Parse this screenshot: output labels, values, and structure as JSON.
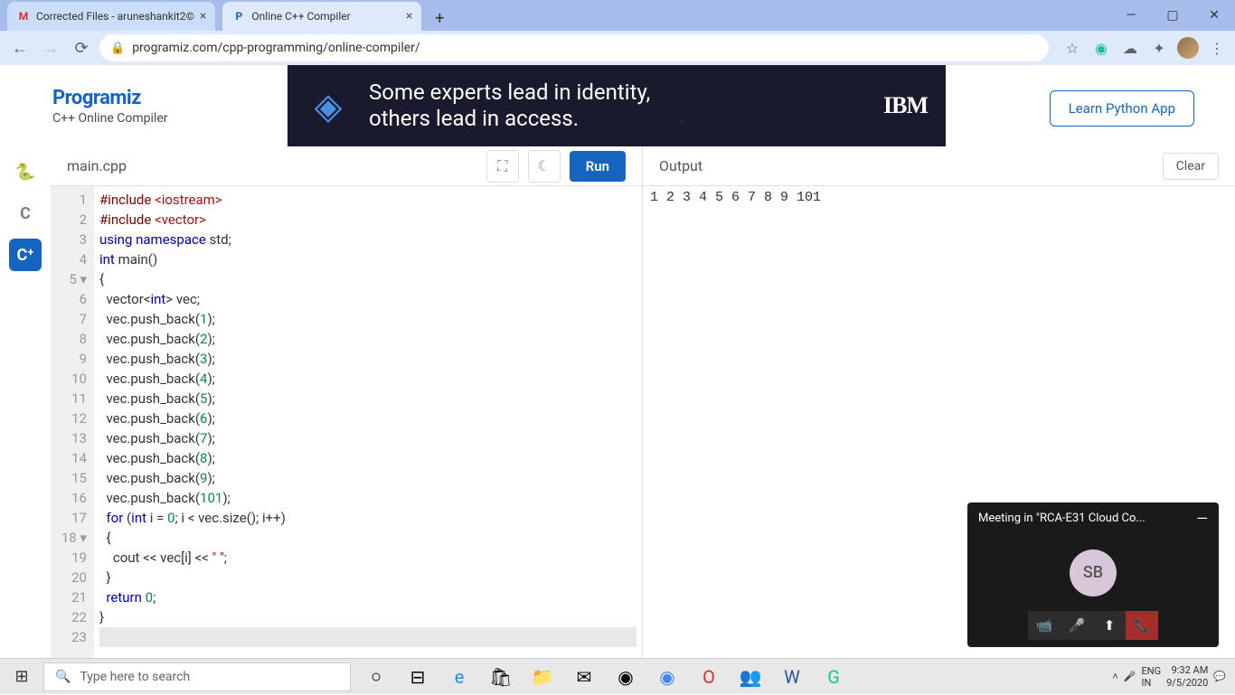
{
  "tabs": [
    {
      "title": "Corrected Files - aruneshankit2©",
      "favicon": "M"
    },
    {
      "title": "Online C++ Compiler",
      "favicon": "P"
    }
  ],
  "url": "programiz.com/cpp-programming/online-compiler/",
  "logo": {
    "text": "Programiz",
    "sub": "C++ Online Compiler"
  },
  "ad": {
    "line1": "Some experts lead in identity,",
    "line2": "others lead in access.",
    "brand": "IBM"
  },
  "learn_btn": "Learn Python App",
  "sidebar_icons": [
    "Py",
    "C",
    "C++"
  ],
  "filename": "main.cpp",
  "run_label": "Run",
  "output_label": "Output",
  "clear_label": "Clear",
  "output_text": "1 2 3 4 5 6 7 8 9 101 ",
  "code_lines": [
    {
      "n": "1",
      "html": "<span class='inc'>#include</span> <span class='str'>&lt;iostream&gt;</span>"
    },
    {
      "n": "2",
      "html": "<span class='inc'>#include</span> <span class='str'>&lt;vector&gt;</span>"
    },
    {
      "n": "3",
      "html": "<span class='kw'>using</span> <span class='kw'>namespace</span> std;"
    },
    {
      "n": "4",
      "html": "<span class='kw'>int</span> main()"
    },
    {
      "n": "5 ▾",
      "html": "{"
    },
    {
      "n": "6",
      "html": "  vector&lt;<span class='kw'>int</span>&gt; vec;"
    },
    {
      "n": "7",
      "html": "  vec.push_back(<span class='num'>1</span>);"
    },
    {
      "n": "8",
      "html": "  vec.push_back(<span class='num'>2</span>);"
    },
    {
      "n": "9",
      "html": "  vec.push_back(<span class='num'>3</span>);"
    },
    {
      "n": "10",
      "html": "  vec.push_back(<span class='num'>4</span>);"
    },
    {
      "n": "11",
      "html": "  vec.push_back(<span class='num'>5</span>);"
    },
    {
      "n": "12",
      "html": "  vec.push_back(<span class='num'>6</span>);"
    },
    {
      "n": "13",
      "html": "  vec.push_back(<span class='num'>7</span>);"
    },
    {
      "n": "14",
      "html": "  vec.push_back(<span class='num'>8</span>);"
    },
    {
      "n": "15",
      "html": "  vec.push_back(<span class='num'>9</span>);"
    },
    {
      "n": "16",
      "html": "  vec.push_back(<span class='num'>101</span>);"
    },
    {
      "n": "17",
      "html": "  <span class='kw'>for</span> (<span class='kw'>int</span> i = <span class='num'>0</span>; i &lt; vec.size(); i++)"
    },
    {
      "n": "18 ▾",
      "html": "  {"
    },
    {
      "n": "19",
      "html": "    cout &lt;&lt; vec[i] &lt;&lt; <span class='str'>\" \"</span>;"
    },
    {
      "n": "20",
      "html": "  }"
    },
    {
      "n": "21",
      "html": "  <span class='kw'>return</span> <span class='num'>0</span>;"
    },
    {
      "n": "22",
      "html": "}"
    },
    {
      "n": "23",
      "html": ""
    }
  ],
  "teams": {
    "title": "Meeting in \"RCA-E31 Cloud Co...",
    "avatar": "SB"
  },
  "search_placeholder": "Type here to search",
  "tray": {
    "lang1": "ENG",
    "lang2": "IN",
    "time": "9:32 AM",
    "date": "9/5/2020"
  }
}
